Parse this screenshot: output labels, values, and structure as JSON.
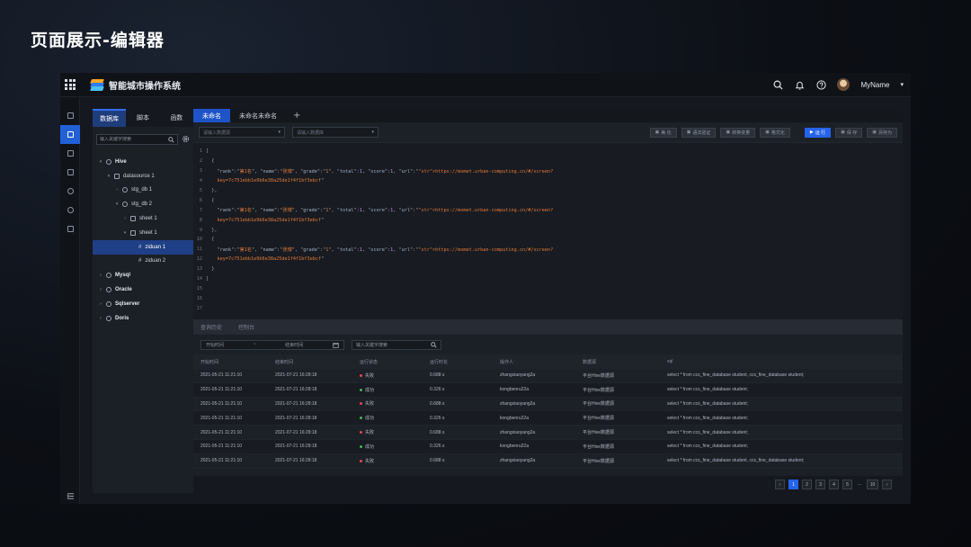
{
  "slide": {
    "title": "页面展示-编辑器"
  },
  "header": {
    "app_name": "智能城市操作系统",
    "user_name": "MyName",
    "icons": [
      "grid-icon",
      "search-icon",
      "bell-icon",
      "help-icon",
      "chevron-down-icon"
    ]
  },
  "explorer": {
    "tabs": [
      "数据库",
      "脚本",
      "函数"
    ],
    "active_tab": 0,
    "search_placeholder": "输入关键字搜索",
    "tree": [
      {
        "label": "Hive",
        "level": 0,
        "icon": "db",
        "bold": true,
        "caret": "▾"
      },
      {
        "label": "datasource 1",
        "level": 1,
        "icon": "box",
        "caret": "▾"
      },
      {
        "label": "stg_db 1",
        "level": 2,
        "icon": "db",
        "caret": "›"
      },
      {
        "label": "stg_db 2",
        "level": 2,
        "icon": "db",
        "caret": "▾"
      },
      {
        "label": "sheet 1",
        "level": 3,
        "icon": "box",
        "caret": "›"
      },
      {
        "label": "sheet 1",
        "level": 3,
        "icon": "box",
        "caret": "▾"
      },
      {
        "label": "ziduan 1",
        "level": 4,
        "icon": "hash",
        "selected": true,
        "caret": ""
      },
      {
        "label": "ziduan 2",
        "level": 4,
        "icon": "hash",
        "caret": ""
      },
      {
        "label": "Mysql",
        "level": 0,
        "icon": "db",
        "bold": true,
        "caret": "›"
      },
      {
        "label": "Oracle",
        "level": 0,
        "icon": "db",
        "bold": true,
        "caret": "›"
      },
      {
        "label": "Sqlserver",
        "level": 0,
        "icon": "db",
        "bold": true,
        "caret": "›"
      },
      {
        "label": "Doris",
        "level": 0,
        "icon": "db",
        "bold": true,
        "caret": "›"
      }
    ]
  },
  "editor": {
    "tabs": [
      "未命名",
      "未命名未命名"
    ],
    "active_tab": 0,
    "add_tab_label": "+",
    "select_datasource_placeholder": "请输入数据源",
    "select_database_placeholder": "请输入数据库",
    "toolbar_buttons": [
      {
        "label": "美 化",
        "primary": false
      },
      {
        "label": "语法验证",
        "primary": false
      },
      {
        "label": "转换变量",
        "primary": false
      },
      {
        "label": "格式化",
        "primary": false
      },
      {
        "label": "运 行",
        "primary": true
      },
      {
        "label": "保 存",
        "primary": false
      },
      {
        "label": "另存为",
        "primary": false
      }
    ],
    "code_lines": [
      "[",
      "  {",
      "    \"rank\":\"第1名\", \"name\":\"张博\", \"grade\":\"1\", \"total\":1, \"score\":1, \"url\":\"https://momet.urban-computing.cn/#/screen?",
      "    key=7c751ebb1e9b6e38a25de1f4f1bf3ebcf\"",
      "  },",
      "  {",
      "    \"rank\":\"第1名\", \"name\":\"张博\", \"grade\":\"1\", \"total\":1, \"score\":1, \"url\":\"https://momet.urban-computing.cn/#/screen?",
      "    key=7c751ebb1e9b6e38a25de1f4f1bf3ebcf\"",
      "  },",
      "  {",
      "    \"rank\":\"第1名\", \"name\":\"张博\", \"grade\":\"1\", \"total\":1, \"score\":1, \"url\":\"https://momet.urban-computing.cn/#/screen?",
      "    key=7c751ebb1e9b6e38a25de1f4f1bf3ebcf\"",
      "  }",
      "]",
      "",
      "",
      ""
    ]
  },
  "results": {
    "tabs": [
      "查询历史",
      "控制台"
    ],
    "active_tab": 0,
    "start_time_placeholder": "开始时间",
    "range_separator": "~",
    "end_time_placeholder": "结束时间",
    "search_placeholder": "输入关键字搜索",
    "columns": [
      "开始时间",
      "结束时间",
      "运行状态",
      "运行时长",
      "操作人",
      "数据源",
      "sql"
    ],
    "rows": [
      {
        "start": "2021-05-21 11:21:10",
        "end": "2021-07-21 16:28:18",
        "status": "失败",
        "status_color": "#e5484d",
        "duration": "0.688 s",
        "user": "zhangxiaoyang2a",
        "source": "平台Hive数据源",
        "sql": "select * from ccs_fine_database student, ccs_fine_database student;"
      },
      {
        "start": "2021-05-21 11:21:10",
        "end": "2021-07-21 16:28:18",
        "status": "成功",
        "status_color": "#3fb950",
        "duration": "0.326 s",
        "user": "kongbenru22a",
        "source": "平台Hive数据源",
        "sql": "select * from ccs_fine_database student;"
      },
      {
        "start": "2021-05-21 11:21:10",
        "end": "2021-07-21 16:28:18",
        "status": "失败",
        "status_color": "#e5484d",
        "duration": "0.688 s",
        "user": "zhangxiaoyang2a",
        "source": "平台Hive数据源",
        "sql": "select * from ccs_fine_database student;"
      },
      {
        "start": "2021-05-21 11:21:10",
        "end": "2021-07-21 16:28:18",
        "status": "成功",
        "status_color": "#3fb950",
        "duration": "0.326 s",
        "user": "kongbenru22a",
        "source": "平台Hive数据源",
        "sql": "select * from ccs_fine_database student;"
      },
      {
        "start": "2021-05-21 11:21:10",
        "end": "2021-07-21 16:28:18",
        "status": "失败",
        "status_color": "#e5484d",
        "duration": "0.688 s",
        "user": "zhangxiaoyang2a",
        "source": "平台Hive数据源",
        "sql": "select * from ccs_fine_database student;"
      },
      {
        "start": "2021-05-21 11:21:10",
        "end": "2021-07-21 16:28:18",
        "status": "成功",
        "status_color": "#3fb950",
        "duration": "0.326 s",
        "user": "kongbenru22a",
        "source": "平台Hive数据源",
        "sql": "select * from ccs_fine_database student;"
      },
      {
        "start": "2021-05-21 11:21:10",
        "end": "2021-07-21 16:28:18",
        "status": "失败",
        "status_color": "#e5484d",
        "duration": "0.688 s",
        "user": "zhangxiaoyang2a",
        "source": "平台Hive数据源",
        "sql": "select * from ccs_fine_database student, ccs_fine_database student;"
      }
    ],
    "pagination": {
      "prev_label": "‹",
      "next_label": "›",
      "pages": [
        "1",
        "2",
        "3",
        "4",
        "5"
      ],
      "ellipsis": "···",
      "last_page": "10",
      "current": "1"
    }
  },
  "colors": {
    "accent": "#2563eb",
    "selected_tree": "#1f3f86",
    "success": "#3fb950",
    "failure": "#e5484d",
    "string_literal": "#e07a3a"
  }
}
